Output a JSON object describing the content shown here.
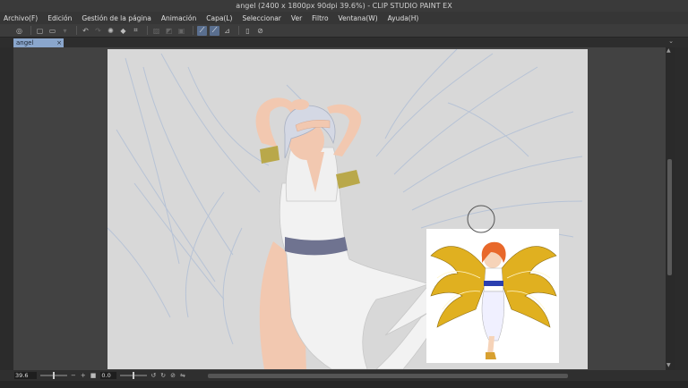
{
  "window": {
    "title": "angel (2400 x 1800px 90dpi 39.6%) - CLIP STUDIO PAINT EX"
  },
  "menu": [
    "Archivo(F)",
    "Edición",
    "Gestión de la página",
    "Animación",
    "Capa(L)",
    "Seleccionar",
    "Ver",
    "Filtro",
    "Ventana(W)",
    "Ayuda(H)"
  ],
  "tab": {
    "label": "angel",
    "close": "×"
  },
  "status": {
    "zoom": "39.6",
    "angle": "0.0",
    "minus": "−",
    "plus": "+"
  },
  "colors": {
    "canvas_bg": "#d8d8d8",
    "skin": "#f2c8b0",
    "hair": "#d4d8e4",
    "sash": "#6f7390",
    "bands": "#b9a84a",
    "wing_lines": "#b7c3d6",
    "ref_wing_gold": "#e0b020",
    "ref_hair": "#e8682a"
  }
}
